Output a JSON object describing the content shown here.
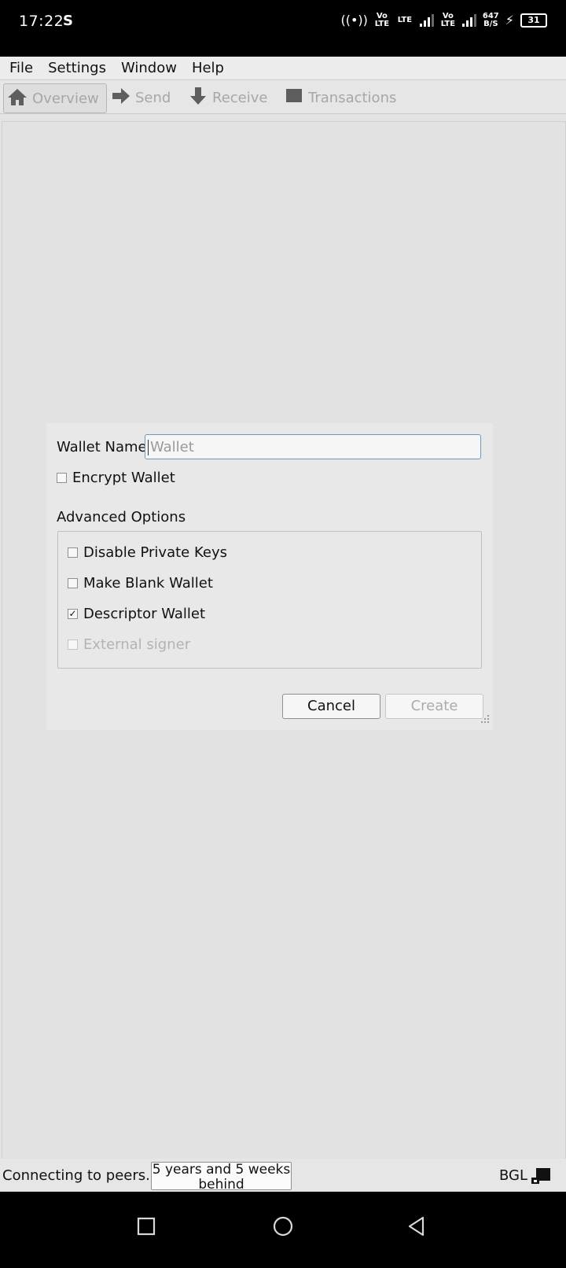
{
  "status_bar": {
    "time": "17:22",
    "carrier_glyph": "S",
    "network_speed": "647\nB/S",
    "battery": "31",
    "labels": [
      "Vo LTE",
      "LTE",
      "Vo LTE"
    ]
  },
  "menu": [
    "File",
    "Settings",
    "Window",
    "Help"
  ],
  "toolbar": {
    "overview": "Overview",
    "send": "Send",
    "receive": "Receive",
    "transactions": "Transactions"
  },
  "dialog": {
    "wallet_name_label": "Wallet Name",
    "wallet_name_placeholder": "Wallet",
    "encrypt_wallet": "Encrypt Wallet",
    "advanced_options": "Advanced Options",
    "disable_private_keys": "Disable Private Keys",
    "make_blank_wallet": "Make Blank Wallet",
    "descriptor_wallet": "Descriptor Wallet",
    "external_signer": "External signer",
    "cancel": "Cancel",
    "create": "Create",
    "checked": {
      "encrypt_wallet": false,
      "disable_private_keys": false,
      "make_blank_wallet": false,
      "descriptor_wallet": true,
      "external_signer": false
    }
  },
  "bottom_status": {
    "connection": "Connecting to peers...",
    "sync_line1": "5 years and 5 weeks",
    "sync_line2": "behind",
    "unit": "BGL"
  },
  "icons": [
    "home-icon",
    "arrow-right-icon",
    "arrow-down-icon",
    "square-icon",
    "checkmark-icon",
    "resize-grip-icon",
    "square-nav-icon",
    "circle-nav-icon",
    "triangle-back-icon"
  ]
}
